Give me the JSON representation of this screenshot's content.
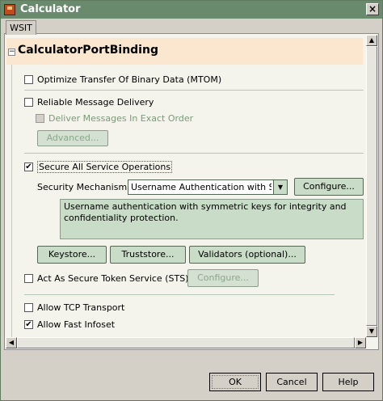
{
  "window": {
    "title": "Calculator"
  },
  "tabs": [
    {
      "label": "WSIT",
      "selected": true
    }
  ],
  "section": {
    "title": "CalculatorPortBinding",
    "toggle": "−"
  },
  "options": {
    "mtom": {
      "label": "Optimize Transfer Of Binary Data (MTOM)",
      "checked": false
    },
    "reliable": {
      "label": "Reliable Message Delivery",
      "checked": false
    },
    "exact_order": {
      "label": "Deliver Messages In Exact Order",
      "checked": false,
      "disabled": true
    },
    "advanced_button": "Advanced...",
    "secure_all": {
      "label": "Secure All Service Operations",
      "checked": true,
      "check_glyph": "✔"
    },
    "security_mechanism_label": "Security Mechanism:",
    "security_mechanism_value": "Username Authentication with S...",
    "configure_button": "Configure...",
    "description": "Username authentication with symmetric keys for integrity and confidentiality protection.",
    "keystore_button": "Keystore...",
    "truststore_button": "Truststore...",
    "validators_button": "Validators (optional)...",
    "sts": {
      "label": "Act As Secure Token Service (STS)",
      "checked": false
    },
    "sts_configure_button": "Configure...",
    "tcp": {
      "label": "Allow TCP Transport",
      "checked": false
    },
    "fast_infoset": {
      "label": "Allow Fast Infoset",
      "checked": true,
      "check_glyph": "✔"
    }
  },
  "dialog_buttons": {
    "ok": "OK",
    "cancel": "Cancel",
    "help": "Help"
  },
  "icons": {
    "close": "×",
    "scroll_up": "▲",
    "scroll_down": "▼",
    "scroll_left": "◀",
    "scroll_right": "▶",
    "dropdown": "▼"
  },
  "colors": {
    "titlebar": "#6a8a6e",
    "header_band": "#fbe7d0",
    "button_fill": "#c9dcc7"
  }
}
